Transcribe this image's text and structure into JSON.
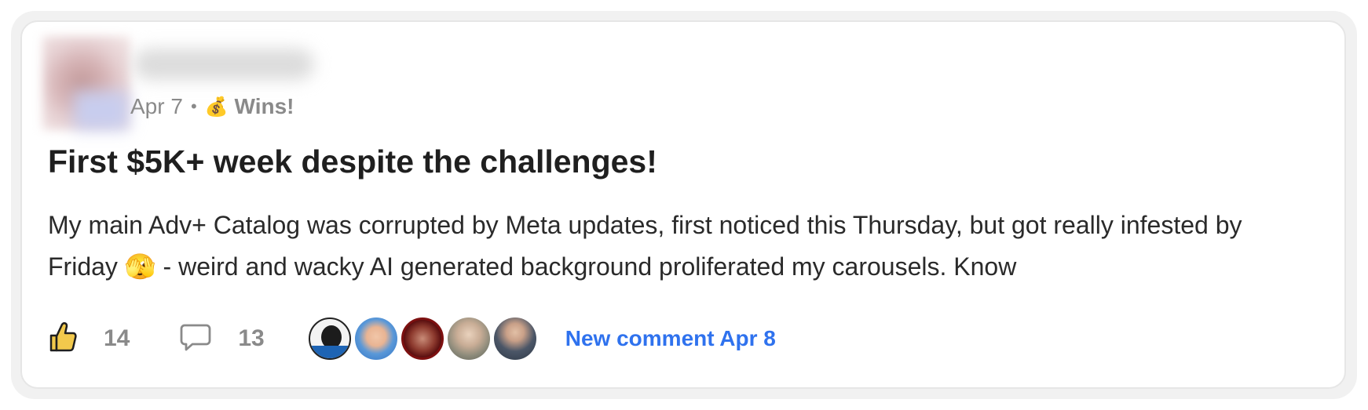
{
  "post": {
    "date": "Apr 7",
    "separator": "•",
    "category_icon": "money-bag",
    "category": "Wins!",
    "title": "First $5K+ week despite the challenges!",
    "body": "My main Adv+ Catalog was corrupted by Meta updates, first noticed this Thursday, but got really infested by Friday 🫣 - weird and wacky AI generated background proliferated my carousels. Know"
  },
  "actions": {
    "like_icon": "thumbs-up-icon",
    "likes": "14",
    "comment_icon": "speech-bubble-icon",
    "comments": "13",
    "new_comment": "New comment Apr 8"
  },
  "colors": {
    "accent_link": "#2f72ee",
    "muted_text": "#8a8a8a",
    "title_text": "#1f1f1f"
  }
}
